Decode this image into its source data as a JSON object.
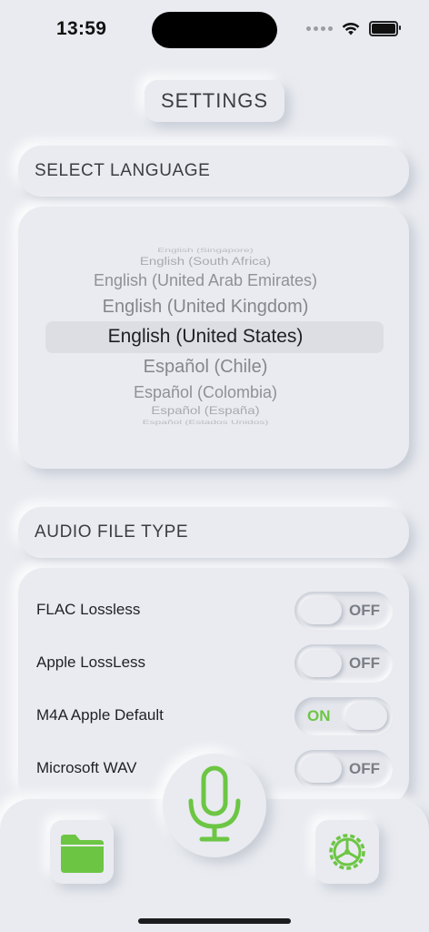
{
  "status_bar": {
    "time": "13:59"
  },
  "title": "SETTINGS",
  "language_section": {
    "header": "SELECT LANGUAGE",
    "options": [
      "English (Singapore)",
      "English (South Africa)",
      "English (United Arab Emirates)",
      "English (United Kingdom)",
      "English (United States)",
      "Español (Chile)",
      "Español (Colombia)",
      "Español (España)",
      "Español (Estados Unidos)"
    ],
    "selected": "English (United States)"
  },
  "audio_section": {
    "header": "AUDIO FILE TYPE",
    "options": [
      {
        "label": "FLAC Lossless",
        "state": "OFF"
      },
      {
        "label": "Apple LossLess",
        "state": "OFF"
      },
      {
        "label": "M4A Apple Default",
        "state": "ON"
      },
      {
        "label": "Microsoft WAV",
        "state": "OFF"
      }
    ]
  },
  "colors": {
    "accent": "#6cc644",
    "background": "#e9ebf0",
    "off_text": "#7a7d84"
  },
  "bottom_bar": {
    "left_icon": "folder-icon",
    "center_icon": "microphone-icon",
    "right_icon": "gear-icon"
  }
}
